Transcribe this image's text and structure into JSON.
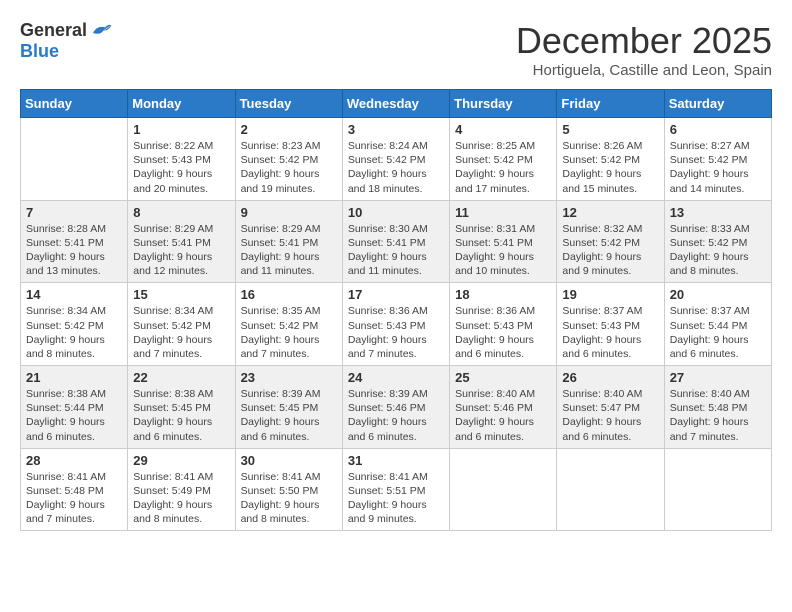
{
  "logo": {
    "general": "General",
    "blue": "Blue"
  },
  "title": "December 2025",
  "location": "Hortiguela, Castille and Leon, Spain",
  "weekdays": [
    "Sunday",
    "Monday",
    "Tuesday",
    "Wednesday",
    "Thursday",
    "Friday",
    "Saturday"
  ],
  "weeks": [
    [
      {
        "day": "",
        "info": ""
      },
      {
        "day": "1",
        "info": "Sunrise: 8:22 AM\nSunset: 5:43 PM\nDaylight: 9 hours\nand 20 minutes."
      },
      {
        "day": "2",
        "info": "Sunrise: 8:23 AM\nSunset: 5:42 PM\nDaylight: 9 hours\nand 19 minutes."
      },
      {
        "day": "3",
        "info": "Sunrise: 8:24 AM\nSunset: 5:42 PM\nDaylight: 9 hours\nand 18 minutes."
      },
      {
        "day": "4",
        "info": "Sunrise: 8:25 AM\nSunset: 5:42 PM\nDaylight: 9 hours\nand 17 minutes."
      },
      {
        "day": "5",
        "info": "Sunrise: 8:26 AM\nSunset: 5:42 PM\nDaylight: 9 hours\nand 15 minutes."
      },
      {
        "day": "6",
        "info": "Sunrise: 8:27 AM\nSunset: 5:42 PM\nDaylight: 9 hours\nand 14 minutes."
      }
    ],
    [
      {
        "day": "7",
        "info": "Sunrise: 8:28 AM\nSunset: 5:41 PM\nDaylight: 9 hours\nand 13 minutes."
      },
      {
        "day": "8",
        "info": "Sunrise: 8:29 AM\nSunset: 5:41 PM\nDaylight: 9 hours\nand 12 minutes."
      },
      {
        "day": "9",
        "info": "Sunrise: 8:29 AM\nSunset: 5:41 PM\nDaylight: 9 hours\nand 11 minutes."
      },
      {
        "day": "10",
        "info": "Sunrise: 8:30 AM\nSunset: 5:41 PM\nDaylight: 9 hours\nand 11 minutes."
      },
      {
        "day": "11",
        "info": "Sunrise: 8:31 AM\nSunset: 5:41 PM\nDaylight: 9 hours\nand 10 minutes."
      },
      {
        "day": "12",
        "info": "Sunrise: 8:32 AM\nSunset: 5:42 PM\nDaylight: 9 hours\nand 9 minutes."
      },
      {
        "day": "13",
        "info": "Sunrise: 8:33 AM\nSunset: 5:42 PM\nDaylight: 9 hours\nand 8 minutes."
      }
    ],
    [
      {
        "day": "14",
        "info": "Sunrise: 8:34 AM\nSunset: 5:42 PM\nDaylight: 9 hours\nand 8 minutes."
      },
      {
        "day": "15",
        "info": "Sunrise: 8:34 AM\nSunset: 5:42 PM\nDaylight: 9 hours\nand 7 minutes."
      },
      {
        "day": "16",
        "info": "Sunrise: 8:35 AM\nSunset: 5:42 PM\nDaylight: 9 hours\nand 7 minutes."
      },
      {
        "day": "17",
        "info": "Sunrise: 8:36 AM\nSunset: 5:43 PM\nDaylight: 9 hours\nand 7 minutes."
      },
      {
        "day": "18",
        "info": "Sunrise: 8:36 AM\nSunset: 5:43 PM\nDaylight: 9 hours\nand 6 minutes."
      },
      {
        "day": "19",
        "info": "Sunrise: 8:37 AM\nSunset: 5:43 PM\nDaylight: 9 hours\nand 6 minutes."
      },
      {
        "day": "20",
        "info": "Sunrise: 8:37 AM\nSunset: 5:44 PM\nDaylight: 9 hours\nand 6 minutes."
      }
    ],
    [
      {
        "day": "21",
        "info": "Sunrise: 8:38 AM\nSunset: 5:44 PM\nDaylight: 9 hours\nand 6 minutes."
      },
      {
        "day": "22",
        "info": "Sunrise: 8:38 AM\nSunset: 5:45 PM\nDaylight: 9 hours\nand 6 minutes."
      },
      {
        "day": "23",
        "info": "Sunrise: 8:39 AM\nSunset: 5:45 PM\nDaylight: 9 hours\nand 6 minutes."
      },
      {
        "day": "24",
        "info": "Sunrise: 8:39 AM\nSunset: 5:46 PM\nDaylight: 9 hours\nand 6 minutes."
      },
      {
        "day": "25",
        "info": "Sunrise: 8:40 AM\nSunset: 5:46 PM\nDaylight: 9 hours\nand 6 minutes."
      },
      {
        "day": "26",
        "info": "Sunrise: 8:40 AM\nSunset: 5:47 PM\nDaylight: 9 hours\nand 6 minutes."
      },
      {
        "day": "27",
        "info": "Sunrise: 8:40 AM\nSunset: 5:48 PM\nDaylight: 9 hours\nand 7 minutes."
      }
    ],
    [
      {
        "day": "28",
        "info": "Sunrise: 8:41 AM\nSunset: 5:48 PM\nDaylight: 9 hours\nand 7 minutes."
      },
      {
        "day": "29",
        "info": "Sunrise: 8:41 AM\nSunset: 5:49 PM\nDaylight: 9 hours\nand 8 minutes."
      },
      {
        "day": "30",
        "info": "Sunrise: 8:41 AM\nSunset: 5:50 PM\nDaylight: 9 hours\nand 8 minutes."
      },
      {
        "day": "31",
        "info": "Sunrise: 8:41 AM\nSunset: 5:51 PM\nDaylight: 9 hours\nand 9 minutes."
      },
      {
        "day": "",
        "info": ""
      },
      {
        "day": "",
        "info": ""
      },
      {
        "day": "",
        "info": ""
      }
    ]
  ]
}
